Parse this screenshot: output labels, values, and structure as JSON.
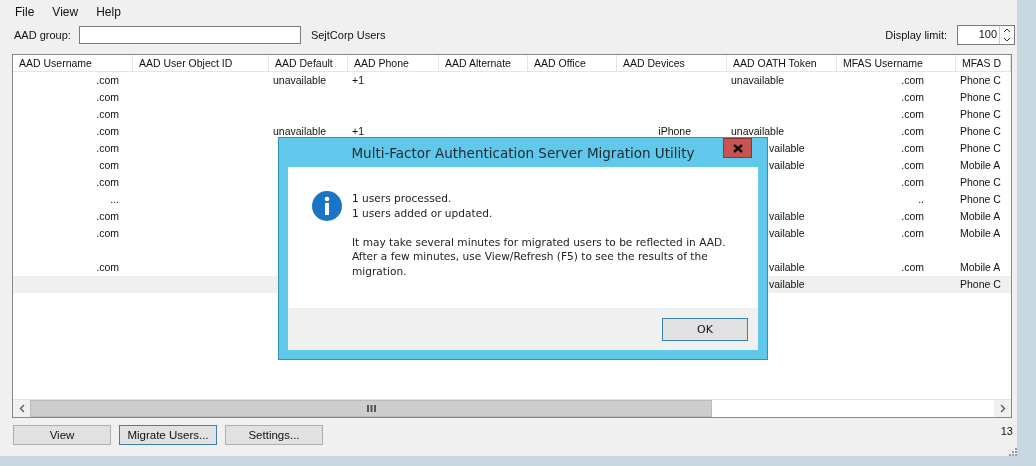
{
  "menu": [
    "File",
    "View",
    "Help"
  ],
  "group_bar": {
    "label": "AAD group:",
    "group_name": "SejtCorp Users",
    "display_limit_label": "Display limit:",
    "display_limit": "100"
  },
  "table": {
    "columns": [
      "AAD Username",
      "AAD User Object ID",
      "AAD Default",
      "AAD Phone",
      "AAD Alternate",
      "AAD Office",
      "AAD Devices",
      "AAD OATH Token",
      "MFAS Username",
      "MFAS D"
    ],
    "rows": [
      {
        "selected": false,
        "aad_username": ".com",
        "aad_default": "unavailable",
        "aad_phone": "+1",
        "aad_oath_token": "unavailable",
        "mfas_username": ".com",
        "mfas_d": "Phone C"
      },
      {
        "selected": false,
        "aad_username": ".com",
        "mfas_username": ".com",
        "mfas_d": "Phone C"
      },
      {
        "selected": false,
        "aad_username": ".com",
        "mfas_username": ".com",
        "mfas_d": "Phone C"
      },
      {
        "selected": false,
        "aad_username": ".com",
        "aad_default": "unavailable",
        "aad_phone": "+1",
        "aad_devices": "iPhone",
        "aad_oath_token": "unavailable",
        "mfas_username": ".com",
        "mfas_d": "Phone C"
      },
      {
        "selected": false,
        "aad_username": ".com",
        "aad_oath_token": "vailable",
        "mfas_username": ".com",
        "mfas_d": "Phone C"
      },
      {
        "selected": false,
        "aad_username": "com",
        "aad_oath_token": "vailable",
        "mfas_username": ".com",
        "mfas_d": "Mobile A"
      },
      {
        "selected": false,
        "aad_username": ".com",
        "mfas_username": ".com",
        "mfas_d": "Phone C"
      },
      {
        "selected": false,
        "aad_username": "...",
        "mfas_username": "..",
        "mfas_d": "Phone C"
      },
      {
        "selected": false,
        "aad_username": ".com",
        "aad_oath_token": "vailable",
        "mfas_username": ".com",
        "mfas_d": "Mobile A"
      },
      {
        "selected": false,
        "aad_username": ".com",
        "aad_oath_token": "vailable",
        "mfas_username": ".com",
        "mfas_d": "Mobile A"
      },
      {
        "selected": false
      },
      {
        "selected": false,
        "aad_username": ".com",
        "aad_oath_token": "vailable",
        "mfas_username": ".com",
        "mfas_d": "Mobile A"
      },
      {
        "selected": true,
        "aad_oath_token": "vailable",
        "mfas_d": "Phone C"
      }
    ]
  },
  "buttons": [
    {
      "label": "View",
      "focused": false
    },
    {
      "label": "Migrate Users...",
      "focused": true
    },
    {
      "label": "Settings...",
      "focused": false
    }
  ],
  "status_count": "13",
  "dialog": {
    "title": "Multi-Factor Authentication Server Migration Utility",
    "lines": [
      "1 users processed.",
      "1 users added or updated."
    ],
    "paragraph": "It may take several minutes for migrated users to be reflected in AAD. After a few minutes, use View/Refresh (F5) to see the results of the migration.",
    "button": "OK"
  }
}
